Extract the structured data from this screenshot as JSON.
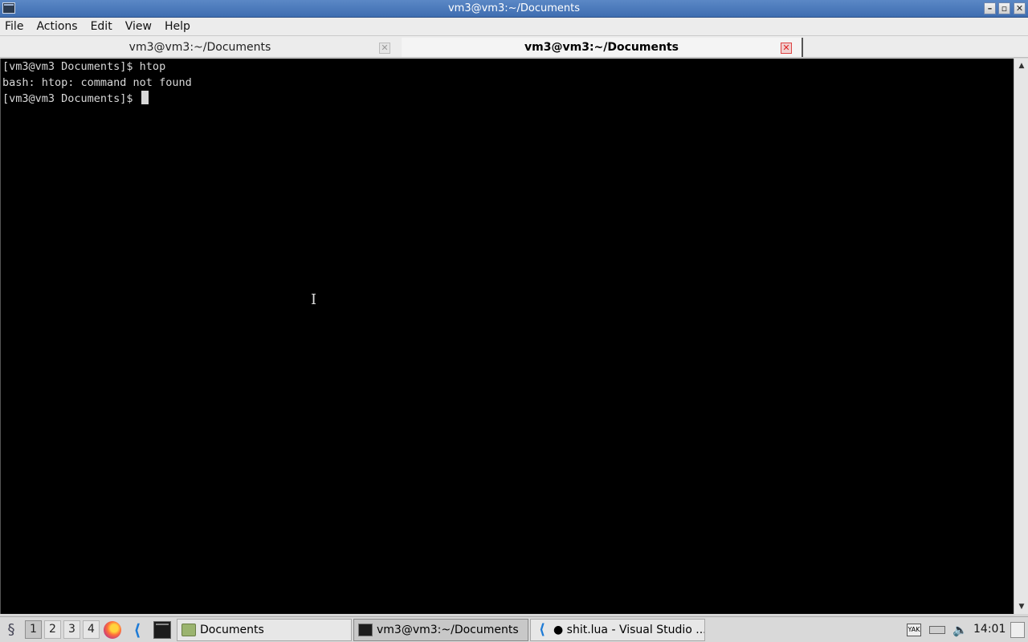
{
  "window": {
    "title": "vm3@vm3:~/Documents",
    "buttons": {
      "minimize": "–",
      "maximize": "▫",
      "close": "✕"
    }
  },
  "menu": [
    "File",
    "Actions",
    "Edit",
    "View",
    "Help"
  ],
  "tabs": [
    {
      "label": "vm3@vm3:~/Documents",
      "close": "✕",
      "active": false
    },
    {
      "label": "vm3@vm3:~/Documents",
      "close": "✕",
      "active": true
    }
  ],
  "terminal": {
    "lines": [
      "[vm3@vm3 Documents]$ htop",
      "bash: htop: command not found",
      "[vm3@vm3 Documents]$ "
    ],
    "mouse_cursor": "I"
  },
  "scrollbar": {
    "up": "▲",
    "down": "▼"
  },
  "taskbar": {
    "workspaces": [
      "1",
      "2",
      "3",
      "4"
    ],
    "active_workspace": "1",
    "launchers": [
      "firefox-icon",
      "vscode-icon",
      "terminal-icon"
    ],
    "tasks": [
      {
        "label": "Documents",
        "icon": "folder-icon"
      },
      {
        "label": "vm3@vm3:~/Documents",
        "icon": "terminal-icon",
        "active": true
      },
      {
        "label": "● shit.lua - Visual Studio ...",
        "icon": "vscode-icon"
      }
    ],
    "tray": {
      "keyboard": "YAK",
      "clock": "14:01"
    }
  },
  "colors": {
    "titlebar": "#4a78bb",
    "terminal_bg": "#000000",
    "terminal_fg": "#d8d8d8"
  }
}
